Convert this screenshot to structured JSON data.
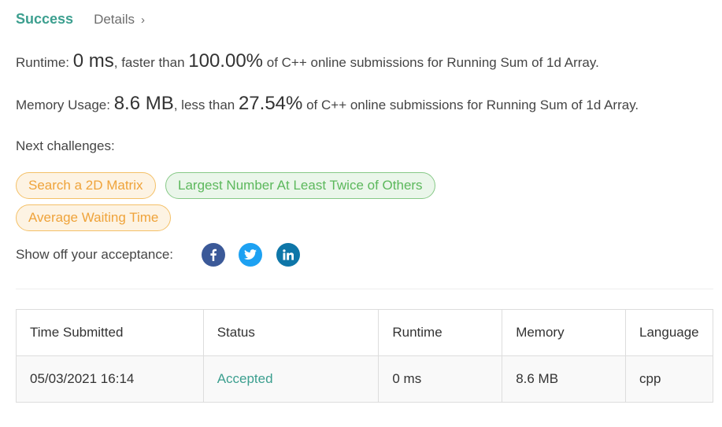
{
  "header": {
    "status": "Success",
    "details_label": "Details",
    "details_chevron": "›"
  },
  "runtime": {
    "label": "Runtime: ",
    "value": "0 ms",
    "mid_text": ", faster than ",
    "percent": "100.00%",
    "suffix": " of C++ online submissions for Running Sum of 1d Array."
  },
  "memory": {
    "label": "Memory Usage: ",
    "value": "8.6 MB",
    "mid_text": ", less than ",
    "percent": "27.54%",
    "suffix": " of C++ online submissions for Running Sum of 1d Array."
  },
  "next_challenges": {
    "title": "Next challenges:",
    "items": [
      {
        "label": "Search a 2D Matrix",
        "difficulty_color": "#efa33a"
      },
      {
        "label": "Largest Number At Least Twice of Others",
        "difficulty_color": "#5cb85c"
      },
      {
        "label": "Average Waiting Time",
        "difficulty_color": "#efa33a"
      }
    ]
  },
  "share": {
    "label": "Show off your acceptance:",
    "icons": [
      {
        "name": "facebook-icon",
        "color": "#3b5998"
      },
      {
        "name": "twitter-icon",
        "color": "#1da1f2"
      },
      {
        "name": "linkedin-icon",
        "color": "#0e76a8"
      }
    ]
  },
  "table": {
    "headers": [
      "Time Submitted",
      "Status",
      "Runtime",
      "Memory",
      "Language"
    ],
    "rows": [
      {
        "time": "05/03/2021 16:14",
        "status": "Accepted",
        "runtime": "0 ms",
        "memory": "8.6 MB",
        "language": "cpp"
      }
    ]
  },
  "colors": {
    "accent": "#3c9f8f",
    "medium": "#efa33a",
    "easy": "#5cb85c"
  }
}
